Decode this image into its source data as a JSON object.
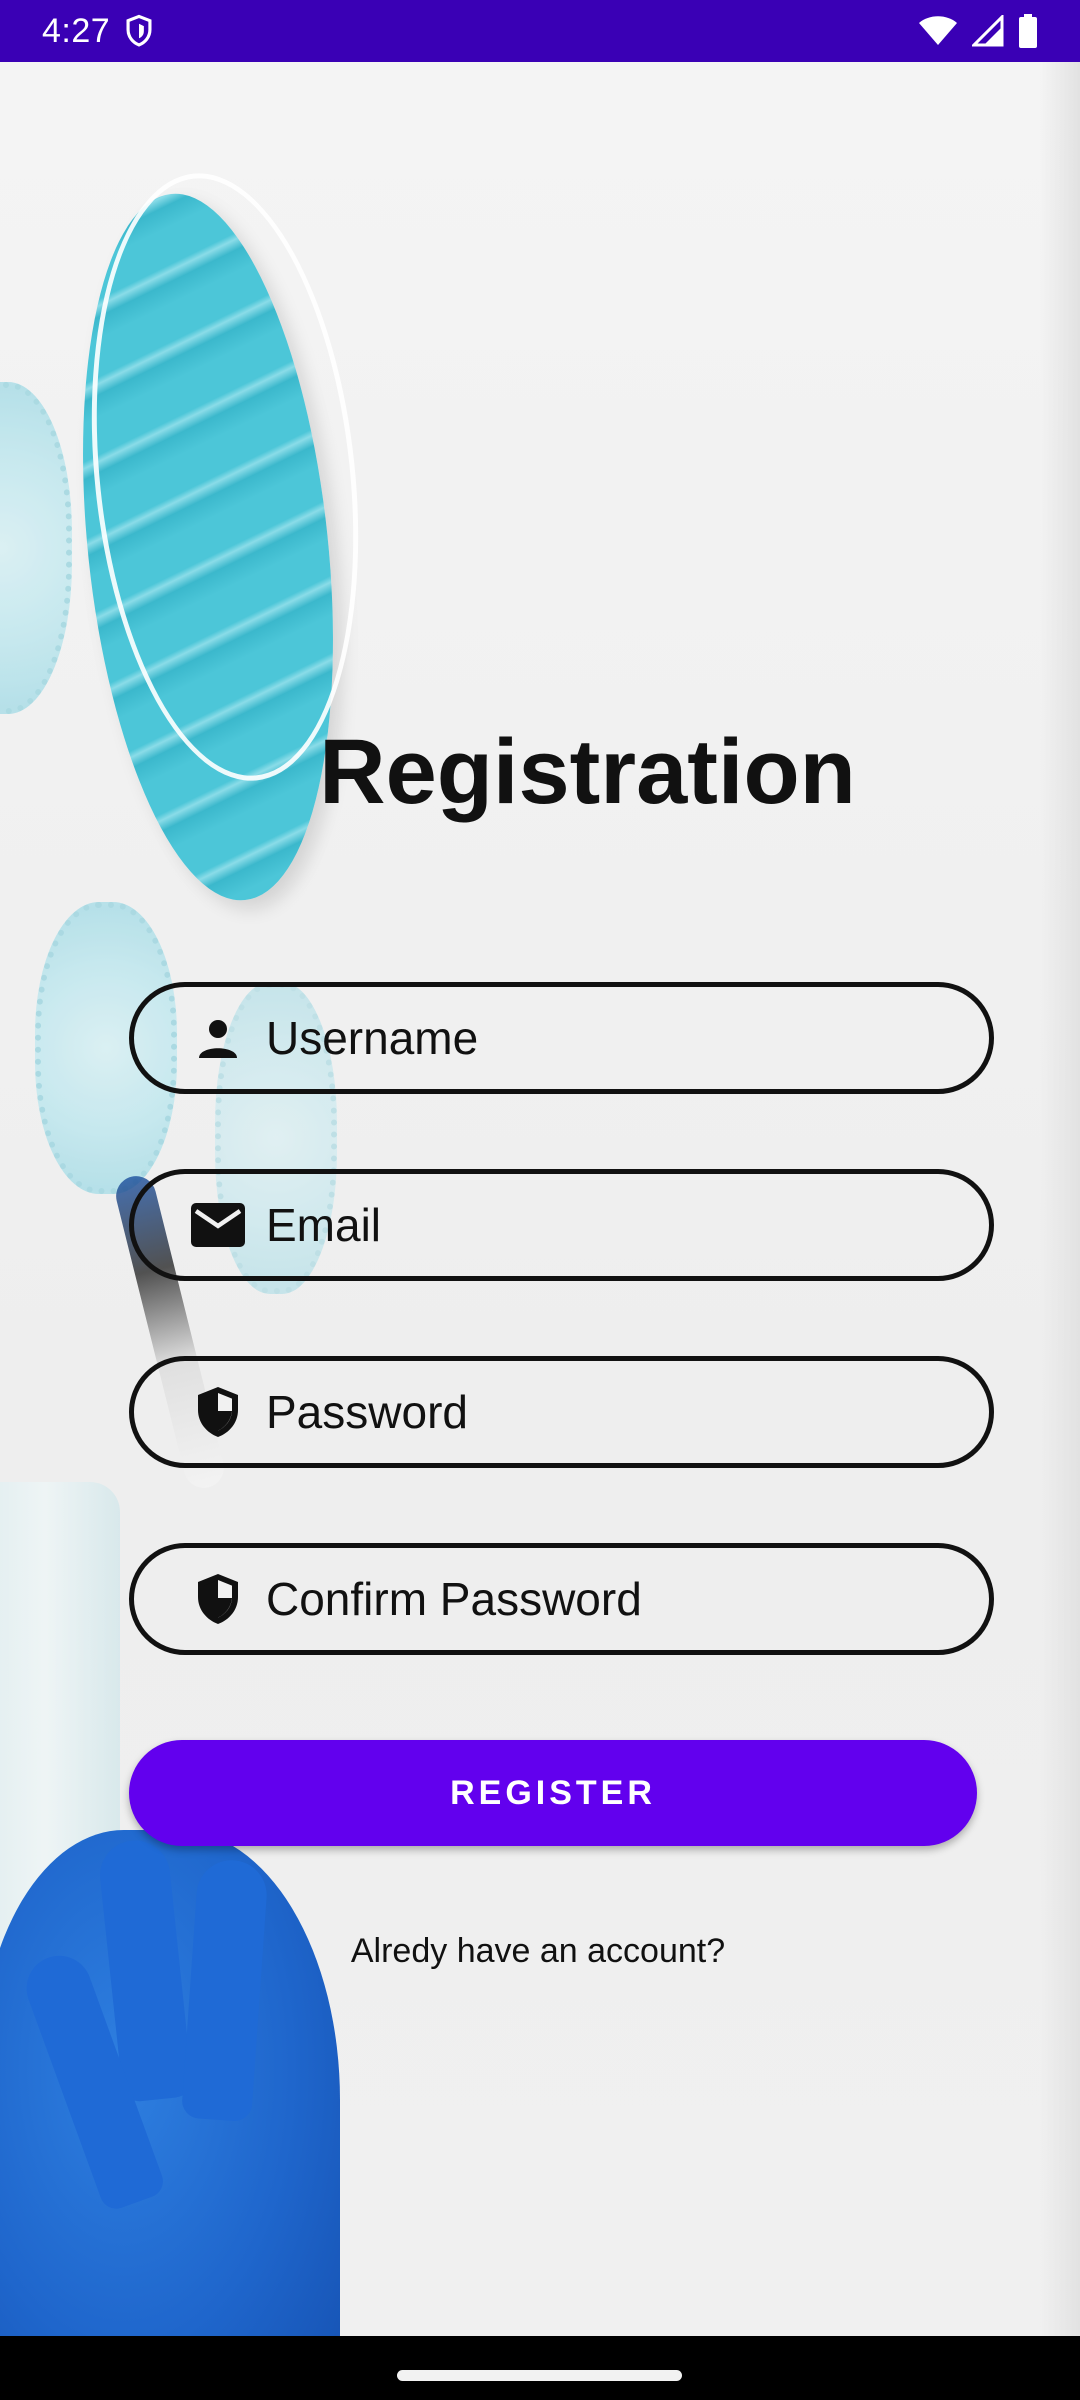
{
  "status_bar": {
    "time": "4:27",
    "icons": [
      "shield-icon",
      "wifi-icon",
      "signal-icon",
      "battery-icon"
    ],
    "color": "#3a00b5"
  },
  "form": {
    "title": "Registration",
    "fields": [
      {
        "icon": "person-icon",
        "placeholder": "Username"
      },
      {
        "icon": "email-icon",
        "placeholder": "Email"
      },
      {
        "icon": "shield-icon",
        "placeholder": "Password"
      },
      {
        "icon": "shield-icon",
        "placeholder": "Confirm Password"
      }
    ],
    "register_label": "REGISTER",
    "login_prompt": "Alredy have an account?"
  },
  "colors": {
    "accent": "#6200ee",
    "text": "#111111"
  }
}
